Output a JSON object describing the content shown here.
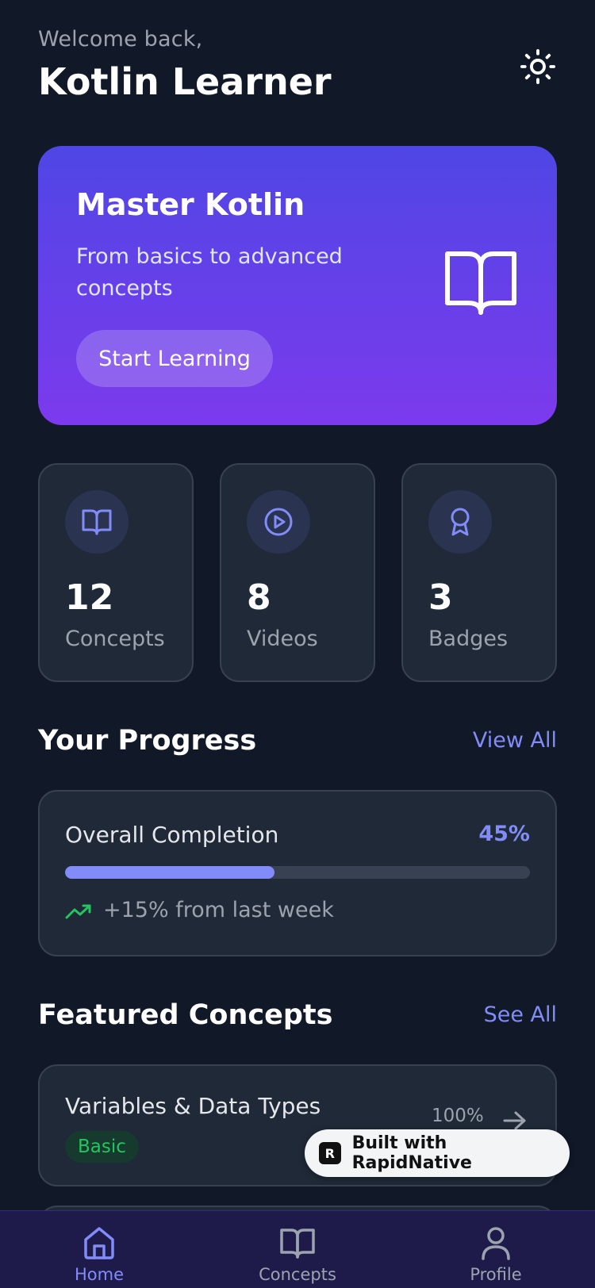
{
  "header": {
    "greeting": "Welcome back,",
    "username": "Kotlin Learner",
    "theme_icon": "sun-icon"
  },
  "hero": {
    "title": "Master Kotlin",
    "subtitle": "From basics to advanced concepts",
    "button_label": "Start Learning",
    "icon": "book-open-icon"
  },
  "stats": [
    {
      "value": "12",
      "label": "Concepts",
      "icon": "book-open-icon"
    },
    {
      "value": "8",
      "label": "Videos",
      "icon": "play-circle-icon"
    },
    {
      "value": "3",
      "label": "Badges",
      "icon": "award-icon"
    }
  ],
  "progress": {
    "section_title": "Your Progress",
    "view_all": "View All",
    "label": "Overall Completion",
    "percent_text": "45%",
    "percent_value": 45,
    "trend_text": "+15% from last week"
  },
  "featured": {
    "section_title": "Featured Concepts",
    "see_all": "See All",
    "items": [
      {
        "title": "Variables & Data Types",
        "level": "Basic",
        "percent": "100%"
      }
    ]
  },
  "built_badge": {
    "text": "Built with RapidNative",
    "logo_letter": "R"
  },
  "tabs": [
    {
      "label": "Home",
      "icon": "home-icon",
      "active": true
    },
    {
      "label": "Concepts",
      "icon": "book-open-icon",
      "active": false
    },
    {
      "label": "Profile",
      "icon": "user-icon",
      "active": false
    }
  ],
  "colors": {
    "background": "#111827",
    "card": "#1f2937",
    "accent": "#818cf8",
    "success": "#22c55e",
    "tab_active": "#818cf8",
    "tab_inactive": "#9ca3af"
  }
}
